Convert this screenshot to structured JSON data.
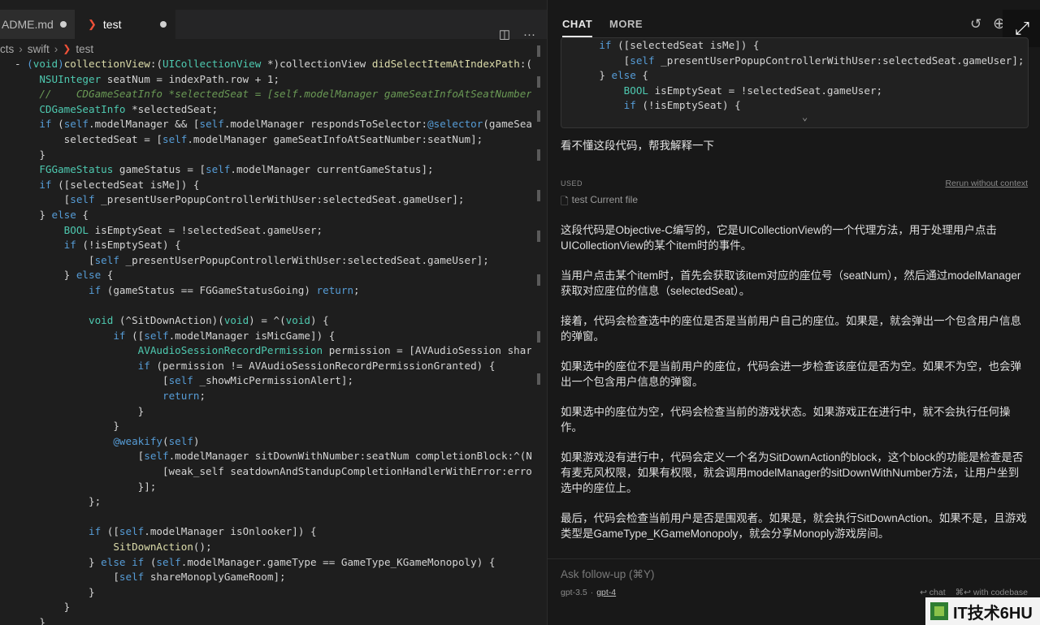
{
  "editor": {
    "tabs": [
      {
        "label": "ADME.md",
        "modified": true
      },
      {
        "label": "test",
        "modified": true,
        "active": true
      }
    ],
    "breadcrumb": [
      "cts",
      "swift",
      "test"
    ],
    "code_lines": [
      [
        [
          "pl",
          "- "
        ],
        [
          "kw",
          "("
        ],
        [
          "ty",
          "void"
        ],
        [
          "kw",
          ")"
        ],
        [
          "fn",
          "collectionView"
        ],
        [
          "pl",
          ":("
        ],
        [
          "ty",
          "UICollectionView"
        ],
        [
          "pl",
          " *)collectionView "
        ],
        [
          "fn",
          "didSelectItemAtIndexPath"
        ],
        [
          "pl",
          ":(NSIn"
        ]
      ],
      [
        [
          "pl",
          "    "
        ],
        [
          "ty",
          "NSUInteger"
        ],
        [
          "pl",
          " seatNum = indexPath.row + 1;"
        ]
      ],
      [
        [
          "cm",
          "    //    CDGameSeatInfo *selectedSeat = [self.modelManager gameSeatInfoAtSeatNumber:se"
        ]
      ],
      [
        [
          "pl",
          "    "
        ],
        [
          "ty",
          "CDGameSeatInfo"
        ],
        [
          "pl",
          " *selectedSeat;"
        ]
      ],
      [
        [
          "pl",
          "    "
        ],
        [
          "kw",
          "if"
        ],
        [
          "pl",
          " ("
        ],
        [
          "kw",
          "self"
        ],
        [
          "pl",
          ".modelManager && ["
        ],
        [
          "kw",
          "self"
        ],
        [
          "pl",
          ".modelManager respondsToSelector:"
        ],
        [
          "kw",
          "@selector"
        ],
        [
          "pl",
          "(gameSeatInf"
        ]
      ],
      [
        [
          "pl",
          "        selectedSeat = ["
        ],
        [
          "kw",
          "self"
        ],
        [
          "pl",
          ".modelManager gameSeatInfoAtSeatNumber:seatNum];"
        ]
      ],
      [
        [
          "pl",
          "    }"
        ]
      ],
      [
        [
          "pl",
          "    "
        ],
        [
          "ty",
          "FGGameStatus"
        ],
        [
          "pl",
          " gameStatus = ["
        ],
        [
          "kw",
          "self"
        ],
        [
          "pl",
          ".modelManager currentGameStatus];"
        ]
      ],
      [
        [
          "pl",
          "    "
        ],
        [
          "kw",
          "if"
        ],
        [
          "pl",
          " ([selectedSeat isMe]) {"
        ]
      ],
      [
        [
          "pl",
          "        ["
        ],
        [
          "kw",
          "self"
        ],
        [
          "pl",
          " _presentUserPopupControllerWithUser:selectedSeat.gameUser];"
        ]
      ],
      [
        [
          "pl",
          "    } "
        ],
        [
          "kw",
          "else"
        ],
        [
          "pl",
          " {"
        ]
      ],
      [
        [
          "pl",
          "        "
        ],
        [
          "ty",
          "BOOL"
        ],
        [
          "pl",
          " isEmptySeat = !selectedSeat.gameUser;"
        ]
      ],
      [
        [
          "pl",
          "        "
        ],
        [
          "kw",
          "if"
        ],
        [
          "pl",
          " (!isEmptySeat) {"
        ]
      ],
      [
        [
          "pl",
          "            ["
        ],
        [
          "kw",
          "self"
        ],
        [
          "pl",
          " _presentUserPopupControllerWithUser:selectedSeat.gameUser];"
        ]
      ],
      [
        [
          "pl",
          "        } "
        ],
        [
          "kw",
          "else"
        ],
        [
          "pl",
          " {"
        ]
      ],
      [
        [
          "pl",
          "            "
        ],
        [
          "kw",
          "if"
        ],
        [
          "pl",
          " (gameStatus == FGGameStatusGoing) "
        ],
        [
          "kw",
          "return"
        ],
        [
          "pl",
          ";"
        ]
      ],
      [
        [
          "pl",
          ""
        ]
      ],
      [
        [
          "pl",
          "            "
        ],
        [
          "ty",
          "void"
        ],
        [
          "pl",
          " (^SitDownAction)("
        ],
        [
          "ty",
          "void"
        ],
        [
          "pl",
          ") = ^("
        ],
        [
          "ty",
          "void"
        ],
        [
          "pl",
          ") {"
        ]
      ],
      [
        [
          "pl",
          "                "
        ],
        [
          "kw",
          "if"
        ],
        [
          "pl",
          " (["
        ],
        [
          "kw",
          "self"
        ],
        [
          "pl",
          ".modelManager isMicGame]) {"
        ]
      ],
      [
        [
          "pl",
          "                    "
        ],
        [
          "ty",
          "AVAudioSessionRecordPermission"
        ],
        [
          "pl",
          " permission = [AVAudioSession sharedIn"
        ]
      ],
      [
        [
          "pl",
          "                    "
        ],
        [
          "kw",
          "if"
        ],
        [
          "pl",
          " (permission != AVAudioSessionRecordPermissionGranted) {"
        ]
      ],
      [
        [
          "pl",
          "                        ["
        ],
        [
          "kw",
          "self"
        ],
        [
          "pl",
          " _showMicPermissionAlert];"
        ]
      ],
      [
        [
          "pl",
          "                        "
        ],
        [
          "kw",
          "return"
        ],
        [
          "pl",
          ";"
        ]
      ],
      [
        [
          "pl",
          "                    }"
        ]
      ],
      [
        [
          "pl",
          "                }"
        ]
      ],
      [
        [
          "pl",
          "                "
        ],
        [
          "kw",
          "@weakify"
        ],
        [
          "pl",
          "("
        ],
        [
          "kw",
          "self"
        ],
        [
          "pl",
          ")"
        ]
      ],
      [
        [
          "pl",
          "                    ["
        ],
        [
          "kw",
          "self"
        ],
        [
          "pl",
          ".modelManager sitDownWithNumber:seatNum completionBlock:^(NSErr"
        ]
      ],
      [
        [
          "pl",
          "                        [weak_self seatdownAndStandupCompletionHandlerWithError:error];"
        ]
      ],
      [
        [
          "pl",
          "                    }];"
        ]
      ],
      [
        [
          "pl",
          "            };"
        ]
      ],
      [
        [
          "pl",
          ""
        ]
      ],
      [
        [
          "pl",
          "            "
        ],
        [
          "kw",
          "if"
        ],
        [
          "pl",
          " (["
        ],
        [
          "kw",
          "self"
        ],
        [
          "pl",
          ".modelManager isOnlooker]) {"
        ]
      ],
      [
        [
          "pl",
          "                "
        ],
        [
          "fn",
          "SitDownAction"
        ],
        [
          "pl",
          "();"
        ]
      ],
      [
        [
          "pl",
          "            } "
        ],
        [
          "kw",
          "else if"
        ],
        [
          "pl",
          " ("
        ],
        [
          "kw",
          "self"
        ],
        [
          "pl",
          ".modelManager.gameType == GameType_KGameMonopoly) {"
        ]
      ],
      [
        [
          "pl",
          "                ["
        ],
        [
          "kw",
          "self"
        ],
        [
          "pl",
          " shareMonoplyGameRoom];"
        ]
      ],
      [
        [
          "pl",
          "            }"
        ]
      ],
      [
        [
          "pl",
          "        }"
        ]
      ],
      [
        [
          "pl",
          "    }"
        ]
      ]
    ]
  },
  "chat": {
    "tabs": [
      "CHAT",
      "MORE"
    ],
    "snippet_lines": [
      [
        [
          "pl",
          "    "
        ],
        [
          "kw",
          "if"
        ],
        [
          "pl",
          " ([selectedSeat isMe]) {"
        ]
      ],
      [
        [
          "pl",
          "        ["
        ],
        [
          "kw",
          "self"
        ],
        [
          "pl",
          " _presentUserPopupControllerWithUser:selectedSeat.gameUser];"
        ]
      ],
      [
        [
          "pl",
          "    } "
        ],
        [
          "kw",
          "else"
        ],
        [
          "pl",
          " {"
        ]
      ],
      [
        [
          "pl",
          "        "
        ],
        [
          "ty",
          "BOOL"
        ],
        [
          "pl",
          " isEmptySeat = !selectedSeat.gameUser;"
        ]
      ],
      [
        [
          "pl",
          "        "
        ],
        [
          "kw",
          "if"
        ],
        [
          "pl",
          " (!isEmptySeat) {"
        ]
      ]
    ],
    "user_message": "看不懂这段代码，帮我解释一下",
    "used_label": "USED",
    "rerun_label": "Rerun without context",
    "context_file": "test Current file",
    "answer_paragraphs": [
      "这段代码是Objective-C编写的，它是UICollectionView的一个代理方法，用于处理用户点击UICollectionView的某个item时的事件。",
      "当用户点击某个item时，首先会获取该item对应的座位号（seatNum），然后通过modelManager获取对应座位的信息（selectedSeat）。",
      "接着，代码会检查选中的座位是否是当前用户自己的座位。如果是，就会弹出一个包含用户信息的弹窗。",
      "如果选中的座位不是当前用户的座位，代码会进一步检查该座位是否为空。如果不为空，也会弹出一个包含用户信息的弹窗。",
      "如果选中的座位为空，代码会检查当前的游戏状态。如果游戏正在进行中，就不会执行任何操作。",
      "如果游戏没有进行中，代码会定义一个名为SitDownAction的block，这个block的功能是检查是否有麦克风权限，如果有权限，就会调用modelManager的sitDownWithNumber方法，让用户坐到选中的座位上。",
      "最后，代码会检查当前用户是否是围观者。如果是，就会执行SitDownAction。如果不是，且游戏类型是GameType_KGameMonopoly，就会分享Monoply游戏房间。"
    ],
    "followup_placeholder": "Ask follow-up (⌘Y)",
    "models": [
      "gpt-3.5",
      "gpt-4"
    ],
    "model_separator": "·",
    "hint_chat": "chat",
    "hint_codebase": "with codebase",
    "watermark": "IT技术6HU"
  },
  "icons": {
    "split_editor": "split-editor-icon",
    "more_actions": "more-actions-icon",
    "history": "history-icon",
    "add": "add-icon",
    "expand": "expand-icon"
  }
}
